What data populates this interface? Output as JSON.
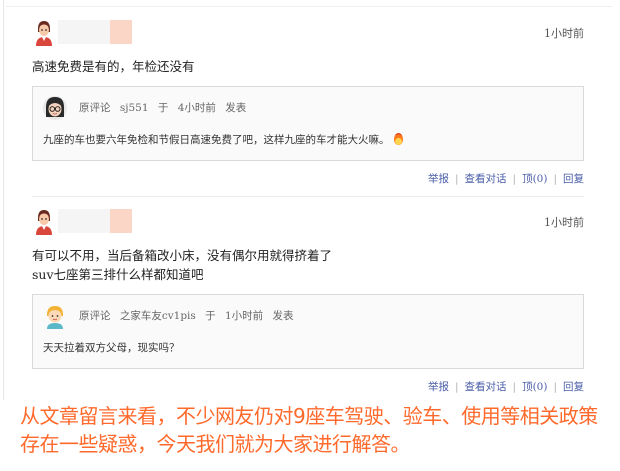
{
  "comments": [
    {
      "time": "1小时前",
      "lines": [
        "高速免费是有的，年检还没有"
      ],
      "quote": {
        "prefix": "原评论",
        "user": "sj551",
        "at": "于",
        "when": "4小时前",
        "verb": "发表",
        "text": "九座的车也要六年免检和节假日高速免费了吧，这样九座的车才能大火嘛。"
      },
      "actions": [
        "举报",
        "查看对话",
        "顶(0)",
        "回复"
      ]
    },
    {
      "time": "1小时前",
      "lines": [
        "有可以不用，当后备箱改小床，没有偶尔用就得挤着了",
        "suv七座第三排什么样都知道吧"
      ],
      "quote": {
        "prefix": "原评论",
        "user": "之家车友cv1pis",
        "at": "于",
        "when": "1小时前",
        "verb": "发表",
        "text": "天天拉着双方父母，现实吗？"
      },
      "actions": [
        "举报",
        "查看对话",
        "顶(0)",
        "回复"
      ]
    }
  ],
  "caption": "从文章留言来看，不少网友仍对9座车驾驶、验车、使用等相关政策存在一些疑惑，今天我们就为大家进行解答。",
  "colors": {
    "caption": "#ff6a2c",
    "link": "#4a5ea8",
    "name_badge": "#fbd6c6"
  },
  "icons": [
    "user-avatar-icon",
    "glasses-avatar-icon",
    "cartoon-avatar-icon",
    "fire-emoji-icon"
  ]
}
